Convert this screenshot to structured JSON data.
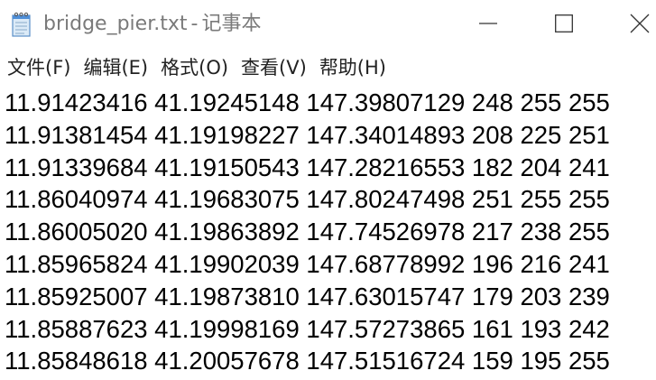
{
  "window": {
    "filename": "bridge_pier.txt",
    "separator": "-",
    "app_name": "记事本"
  },
  "menu": {
    "items": [
      "文件(F)",
      "编辑(E)",
      "格式(O)",
      "查看(V)",
      "帮助(H)"
    ]
  },
  "content": {
    "lines": [
      "11.91423416 41.19245148 147.39807129 248 255 255",
      "11.91381454 41.19198227 147.34014893 208 225 251",
      "11.91339684 41.19150543 147.28216553 182 204 241",
      "11.86040974 41.19683075 147.80247498 251 255 255",
      "11.86005020 41.19863892 147.74526978 217 238 255",
      "11.85965824 41.19902039 147.68778992 196 216 241",
      "11.85925007 41.19873810 147.63015747 179 203 239",
      "11.85887623 41.19998169 147.57273865 161 193 242",
      "11.85848618 41.20057678 147.51516724 159 195 255"
    ]
  },
  "icons": {
    "app": "notepad-icon",
    "minimize": "minimize-icon",
    "maximize": "maximize-icon",
    "close": "close-icon"
  },
  "colors": {
    "title_text": "#7a7a7a",
    "menu_text": "#222222",
    "content_text": "#000000",
    "background": "#ffffff"
  }
}
